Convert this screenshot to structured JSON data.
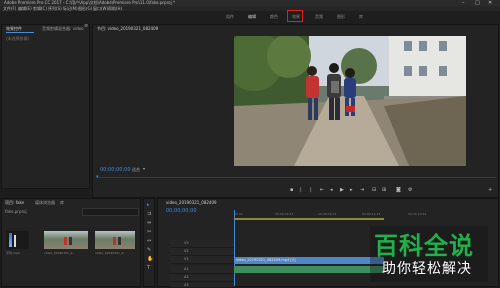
{
  "window_title": "Adobe Premiere Pro CC 2017 - C:\\用户\\App\\文档\\Adobe\\Premiere Pro\\11.0\\fake.prproj *",
  "menu": [
    "文件(F)",
    "编辑(E)",
    "剪辑(C)",
    "序列(S)",
    "标记(M)",
    "图形(G)",
    "窗口(W)",
    "帮助(H)"
  ],
  "workspace_tabs": [
    "组件",
    "编辑",
    "颜色",
    "效果",
    "音频",
    "图形",
    "库"
  ],
  "highlight_color": "#e0201a",
  "source_panel": {
    "tabs": [
      "效果控件",
      "音频剪辑混合器: video"
    ],
    "placeholder": "(未选择剪辑)"
  },
  "program_panel": {
    "tab": "节目: video_20190321_082409",
    "timecode": "00;00;00;00",
    "fit": "适合"
  },
  "project_panel": {
    "tabs": [
      "项目: fake",
      "媒体浏览器",
      "库"
    ],
    "project_file": "fake.prproj",
    "items": [
      {
        "label": "序列.mp4"
      },
      {
        "label": "video_20190321_0..."
      },
      {
        "label": "video_20190321_0..."
      }
    ]
  },
  "timeline": {
    "tab": "video_20190321_082409",
    "timecode": "00;00;00;00",
    "ruler": [
      "00;00",
      "00;00;04;23",
      "00;00;09;23",
      "00;00;14;23",
      "00;00;19;23"
    ],
    "tracks": [
      "V3",
      "V2",
      "V1",
      "A1",
      "A2",
      "A3"
    ],
    "clip_label": "video_20190321_082409.mp4 [V]"
  },
  "watermark": {
    "title": "百科全说",
    "subtitle": "助你轻松解决"
  }
}
